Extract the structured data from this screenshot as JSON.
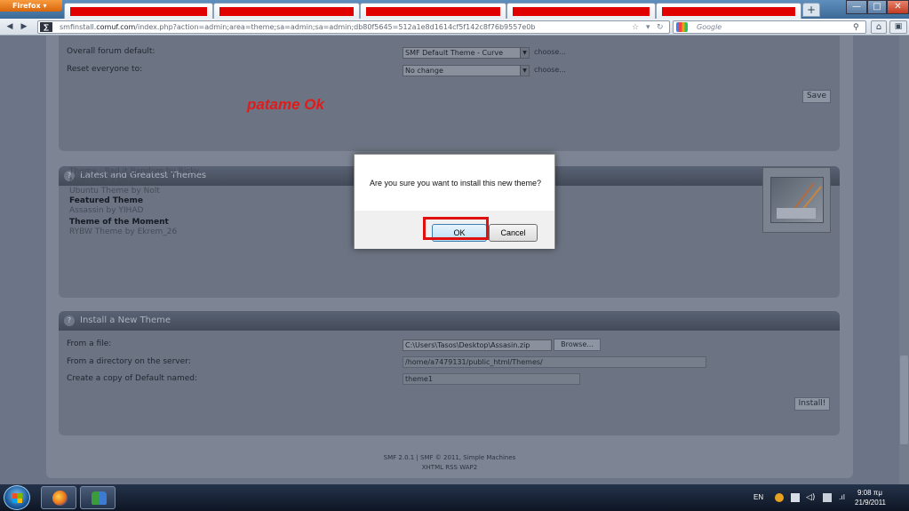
{
  "browser": {
    "menu_button": "Firefox ▾",
    "new_tab": "+",
    "win_minimize": "—",
    "win_maximize": "□",
    "win_close": "✕",
    "url_prefix": "smfinstall.",
    "url_domain": "comuf.com",
    "url_path": "/index.php?action=admin;area=theme;sa=admin;sa=admin;db80f5645=512a1e8d1614cf5f142c8f76b9557e0b",
    "search_placeholder": "Google"
  },
  "page": {
    "overall_label": "Overall forum default:",
    "overall_value": "SMF Default Theme - Curve",
    "reset_label": "Reset everyone to:",
    "reset_value": "No change",
    "choose_text": "choose...",
    "save_label": "Save",
    "annotation": "patame Ok",
    "latest_title": "Latest and Greatest Themes",
    "latest_lines": [
      "Theme : Red it Random by Ricky.",
      "Multi Milk 2 by Gary",
      "Ubuntu Theme by Nolt"
    ],
    "featured_heading": "Featured Theme",
    "featured_value": "Assassin by YIHAD",
    "moment_heading": "Theme of the Moment",
    "moment_value": "RYBW Theme by Ekrem_26",
    "install_title": "Install a New Theme",
    "from_file_label": "From a file:",
    "from_file_value": "C:\\Users\\Tasos\\Desktop\\Assasin.zip",
    "browse_label": "Browse...",
    "from_dir_label": "From a directory on the server:",
    "from_dir_value": "/home/a7479131/public_html/Themes/",
    "copy_label": "Create a copy of Default named:",
    "copy_value": "theme1",
    "install_label": "Install!",
    "footer_line1": "SMF 2.0.1 | SMF © 2011, Simple Machines",
    "footer_line2": "XHTML   RSS   WAP2"
  },
  "dialog": {
    "message": "Are you sure you want to install this new theme?",
    "ok_label": "OK",
    "cancel_label": "Cancel"
  },
  "taskbar": {
    "lang": "EN",
    "time": "9:08 πμ",
    "date": "21/9/2011"
  },
  "colors": {
    "highlight": "#e01010",
    "annotation": "#e21a1a",
    "ok_border": "#3c7fb1"
  }
}
